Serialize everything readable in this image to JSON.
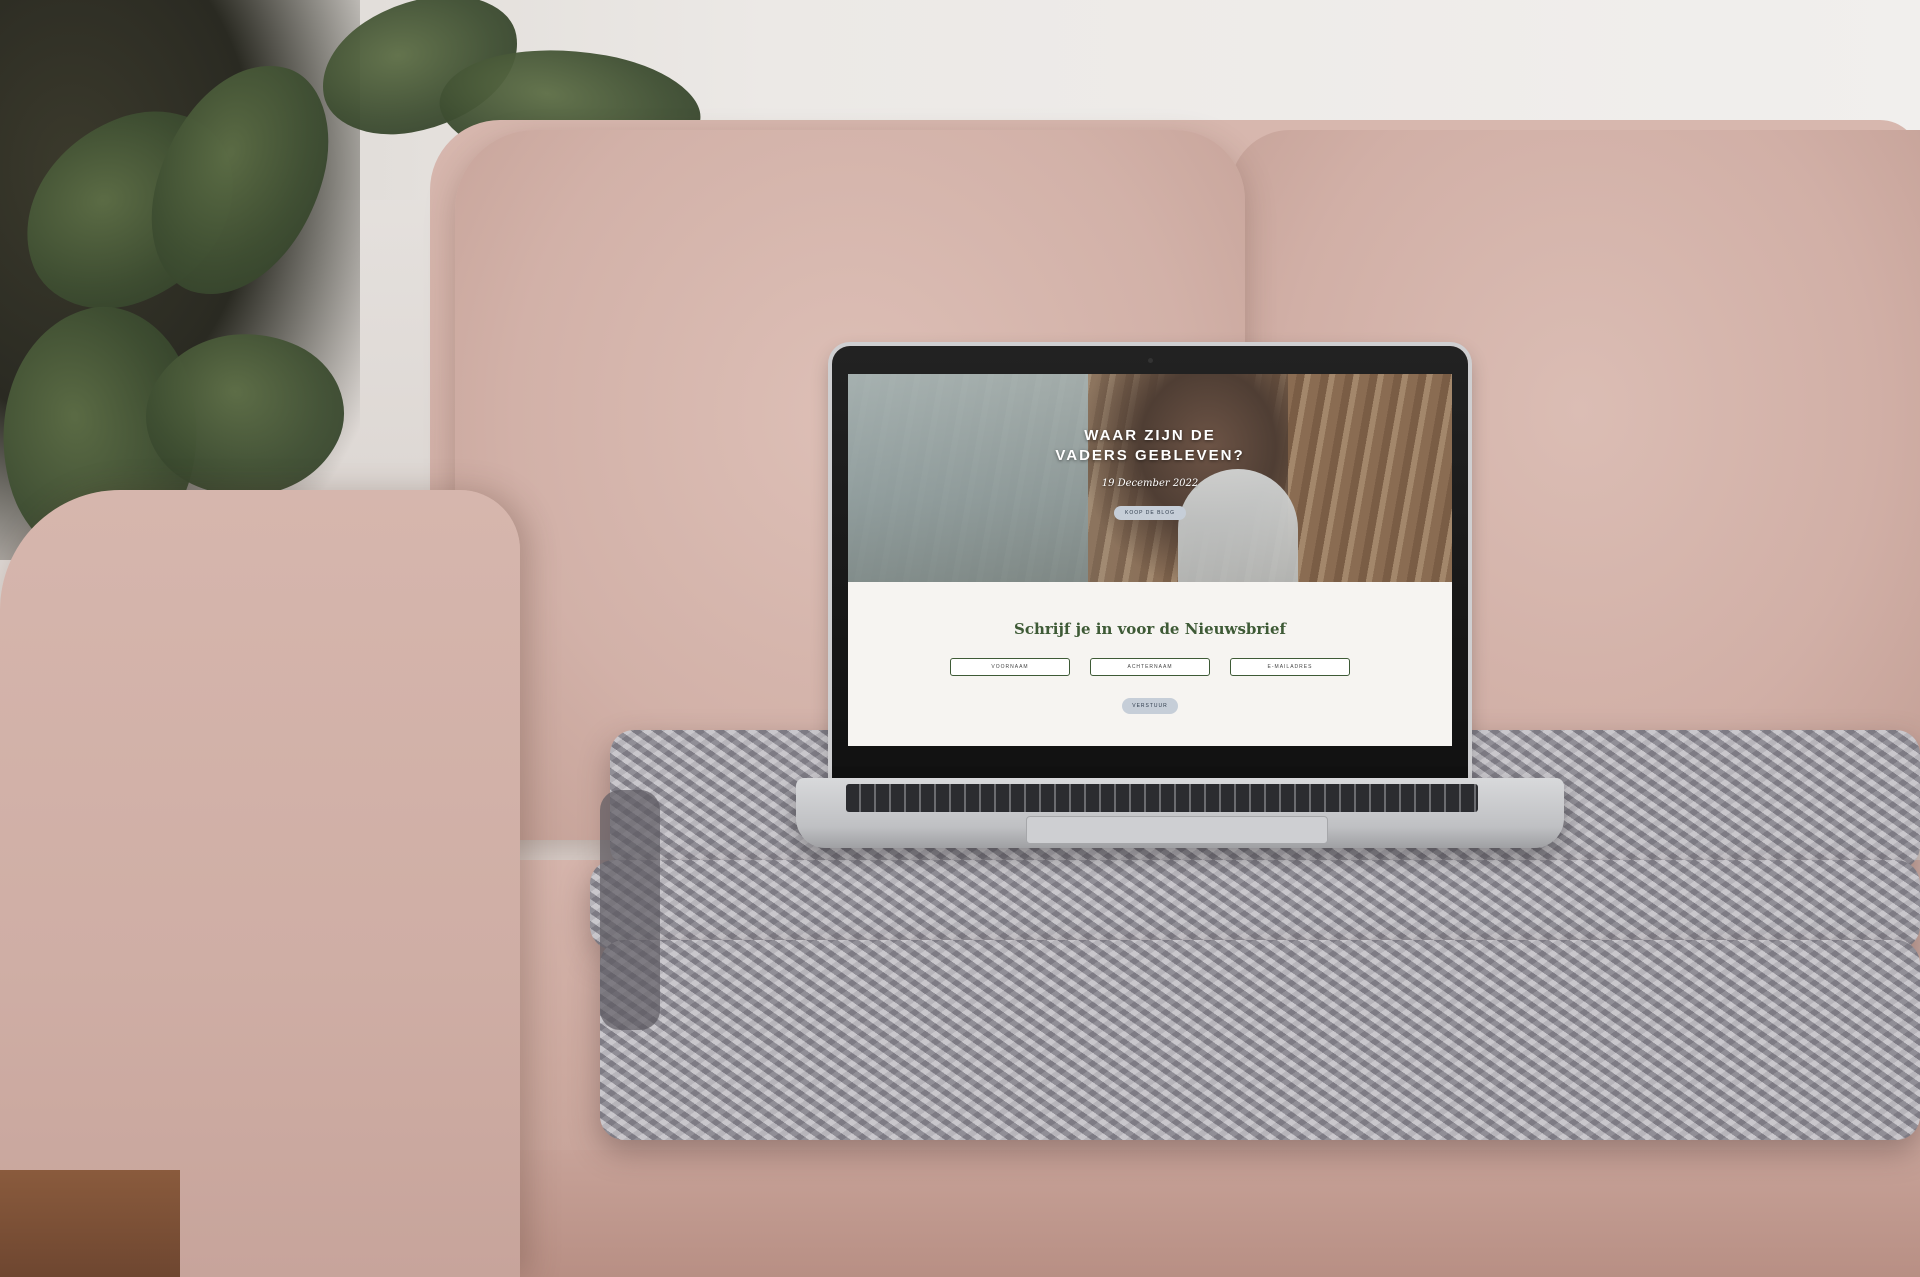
{
  "screen": {
    "hero": {
      "title_line1": "WAAR ZIJN DE",
      "title_line2": "VADERS GEBLEVEN?",
      "date": "19 December 2022",
      "button_label": "KOOP DE BLOG"
    },
    "newsletter": {
      "title": "Schrijf je in voor de Nieuwsbrief",
      "fields": [
        {
          "placeholder": "VOORNAAM"
        },
        {
          "placeholder": "ACHTERNAAM"
        },
        {
          "placeholder": "E-MAILADRES"
        }
      ],
      "submit_label": "VERSTUUR"
    }
  },
  "colors": {
    "sofa": "#d2b1a8",
    "newsletter_title": "#3e5a36",
    "button": "#c6ced8",
    "screen_background": "#f6f4f1"
  }
}
